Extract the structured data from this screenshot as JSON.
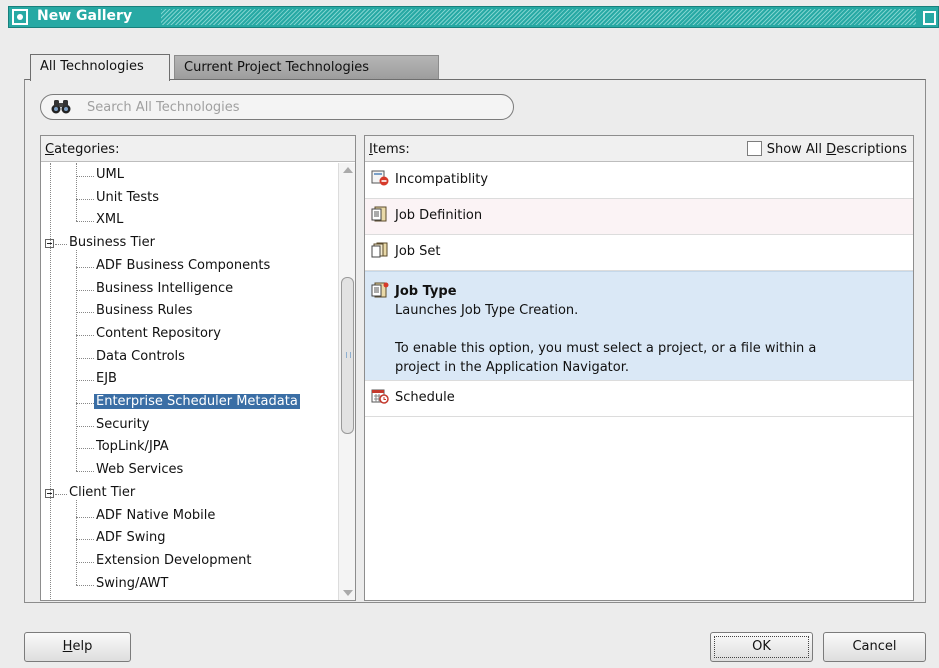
{
  "window": {
    "title": "New Gallery"
  },
  "tabs": [
    {
      "label": "All Technologies",
      "active": true
    },
    {
      "label": "Current Project Technologies",
      "active": false
    }
  ],
  "search": {
    "placeholder": "Search All Technologies",
    "value": ""
  },
  "categories": {
    "header_mnemonic": "C",
    "header_rest": "ategories:",
    "items": [
      {
        "label": "UML",
        "level": 1
      },
      {
        "label": "Unit Tests",
        "level": 1
      },
      {
        "label": "XML",
        "level": 1
      },
      {
        "label": "Business Tier",
        "level": 0,
        "expanded": true
      },
      {
        "label": "ADF Business Components",
        "level": 1
      },
      {
        "label": "Business Intelligence",
        "level": 1
      },
      {
        "label": "Business Rules",
        "level": 1
      },
      {
        "label": "Content Repository",
        "level": 1
      },
      {
        "label": "Data Controls",
        "level": 1
      },
      {
        "label": "EJB",
        "level": 1
      },
      {
        "label": "Enterprise Scheduler Metadata",
        "level": 1,
        "selected": true
      },
      {
        "label": "Security",
        "level": 1
      },
      {
        "label": "TopLink/JPA",
        "level": 1
      },
      {
        "label": "Web Services",
        "level": 1
      },
      {
        "label": "Client Tier",
        "level": 0,
        "expanded": true
      },
      {
        "label": "ADF Native Mobile",
        "level": 1
      },
      {
        "label": "ADF Swing",
        "level": 1
      },
      {
        "label": "Extension Development",
        "level": 1
      },
      {
        "label": "Swing/AWT",
        "level": 1
      }
    ]
  },
  "items_panel": {
    "header_mnemonic": "I",
    "header_rest": "tems:",
    "show_all_pre": "Show All ",
    "show_all_mnemonic": "D",
    "show_all_post": "escriptions",
    "show_all_checked": false,
    "items": [
      {
        "name": "Incompatiblity",
        "icon": "incompatibility-icon"
      },
      {
        "name": "Job Definition",
        "icon": "job-definition-icon"
      },
      {
        "name": "Job Set",
        "icon": "job-set-icon"
      },
      {
        "name": "Job Type",
        "icon": "job-type-icon",
        "selected": true,
        "description": "Launches Job Type Creation.",
        "note_line1": "To enable this option, you must select a project, or a file within a",
        "note_line2": "project in the Application Navigator."
      },
      {
        "name": "Schedule",
        "icon": "schedule-icon"
      }
    ]
  },
  "buttons": {
    "help_mnemonic": "H",
    "help_rest": "elp",
    "ok": "OK",
    "cancel": "Cancel"
  },
  "colors": {
    "titlebar": "#27a9a4",
    "selection": "#3a6ea5",
    "selected_item_bg": "#dae8f6"
  }
}
